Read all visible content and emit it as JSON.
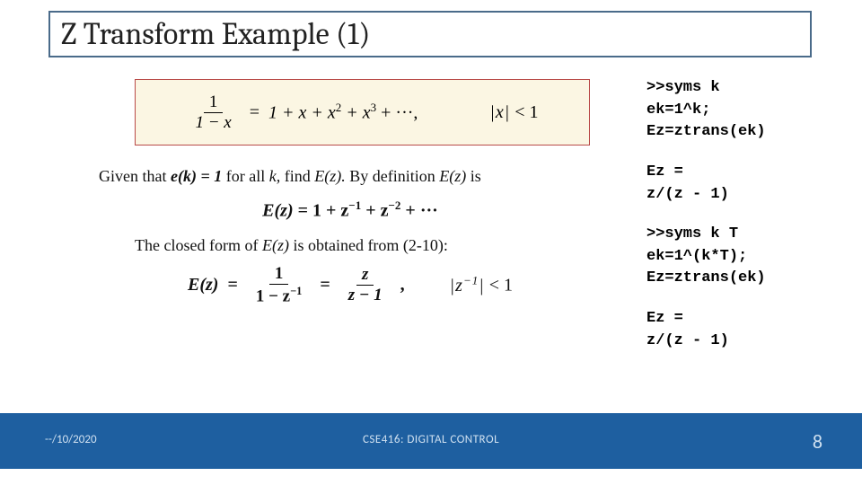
{
  "title": "Z Transform Example (1)",
  "formula": {
    "lhs_num": "1",
    "lhs_den": "1 − x",
    "eq": "=",
    "rhs_series": "1 + x + x",
    "rhs_series_sq": "2",
    "rhs_series_plus": " + x",
    "rhs_series_cu": "3",
    "rhs_series_tail": " + ···,",
    "cond_abs": "|x|",
    "cond_rel": "< 1"
  },
  "body": {
    "given_pre": "Given that ",
    "given_ek": "e(k) = 1",
    "given_mid": " for all ",
    "given_k": "k,",
    "given_find": " find ",
    "given_Ez": "E(z).",
    "given_bydef": " By definition ",
    "given_Ez2": "E(z)",
    "given_is": " is",
    "eq1_lhs": "E(z)",
    "eq1_eq": " = 1 + z",
    "eq1_m1": "−1",
    "eq1_plus": " + z",
    "eq1_m2": "−2",
    "eq1_tail": " + ···",
    "closed_text": "The closed form of ",
    "closed_Ez": "E(z)",
    "closed_tail": " is obtained from (2-10):",
    "eq2_lhs": "E(z)",
    "eq2_eq": "=",
    "eq2_f1_num": "1",
    "eq2_f1_den_pre": "1 − z",
    "eq2_f1_den_exp": "−1",
    "eq2_eq2": "=",
    "eq2_f2_num": "z",
    "eq2_f2_den": "z − 1",
    "eq2_comma": ",",
    "eq2_cond_abs_pre": "|z",
    "eq2_cond_abs_exp": "−1",
    "eq2_cond_abs_post": "|",
    "eq2_cond_rel": " < 1"
  },
  "code": {
    "b1": ">>syms k\nek=1^k;\nEz=ztrans(ek)",
    "b2": "Ez =\nz/(z - 1)",
    "b3": ">>syms k T\nek=1^(k*T);\nEz=ztrans(ek)",
    "b4": "Ez =\nz/(z - 1)"
  },
  "footer": {
    "date": "--/10/2020",
    "course": "CSE416: DIGITAL CONTROL",
    "page": "8"
  }
}
